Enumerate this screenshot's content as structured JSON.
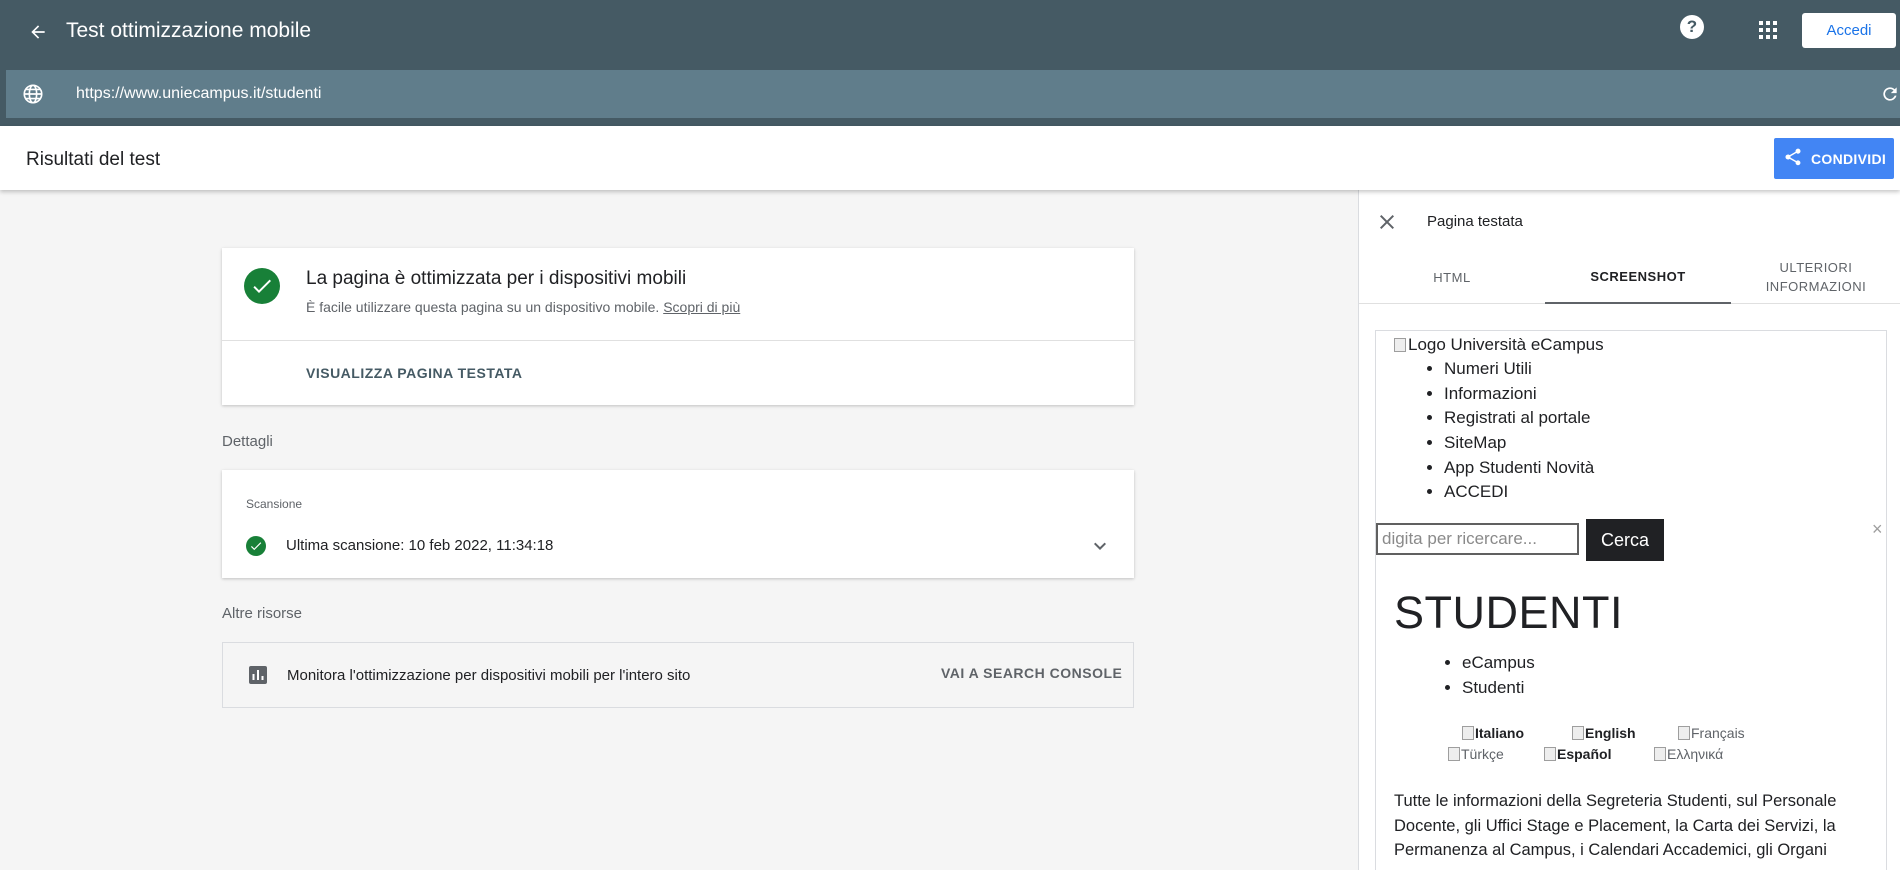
{
  "app": {
    "title": "Test ottimizzazione mobile",
    "login_label": "Accedi",
    "help_glyph": "?",
    "url": "https://www.uniecampus.it/studenti"
  },
  "results": {
    "title": "Risultati del test",
    "share_label": "CONDIVIDI"
  },
  "result_card": {
    "heading": "La pagina è ottimizzata per i dispositivi mobili",
    "subtitle": "È facile utilizzare questa pagina su un dispositivo mobile.",
    "learn_more": "Scopri di più",
    "view_page_label": "VISUALIZZA PAGINA TESTATA"
  },
  "details": {
    "label": "Dettagli",
    "scan_title": "Scansione",
    "last_scan": "Ultima scansione: 10 feb 2022, 11:34:18"
  },
  "resources": {
    "label": "Altre risorse",
    "text": "Monitora l'ottimizzazione per dispositivi mobili per l'intero sito",
    "link_label": "VAI A SEARCH CONSOLE"
  },
  "panel": {
    "title": "Pagina testata",
    "tabs": [
      {
        "label": "HTML"
      },
      {
        "label": "SCREENSHOT"
      },
      {
        "label": "ULTERIORI INFORMAZIONI"
      }
    ],
    "close_glyph": "×"
  },
  "preview": {
    "logo_alt": "Logo Università eCampus",
    "nav": [
      "Numeri Utili",
      "Informazioni",
      "Registrati al portale",
      "SiteMap",
      "App Studenti Novità",
      "ACCEDI"
    ],
    "search_placeholder": "digita per ricercare...",
    "search_button": "Cerca",
    "heading": "STUDENTI",
    "breadcrumbs": [
      "eCampus",
      "Studenti"
    ],
    "languages": [
      "Italiano",
      "English",
      "Français",
      "Türkçe",
      "Español",
      "Ελληνικά"
    ],
    "paragraph": "Tutte le informazioni della Segreteria Studenti, sul Personale Docente, gli Uffici Stage e Placement, la Carta dei Servizi, la Permanenza al Campus, i Calendari Accademici, gli Organi"
  },
  "colors": {
    "appbar": "#455a64",
    "urlbar": "#607d8b",
    "accent": "#4285f4",
    "success": "#188038"
  }
}
